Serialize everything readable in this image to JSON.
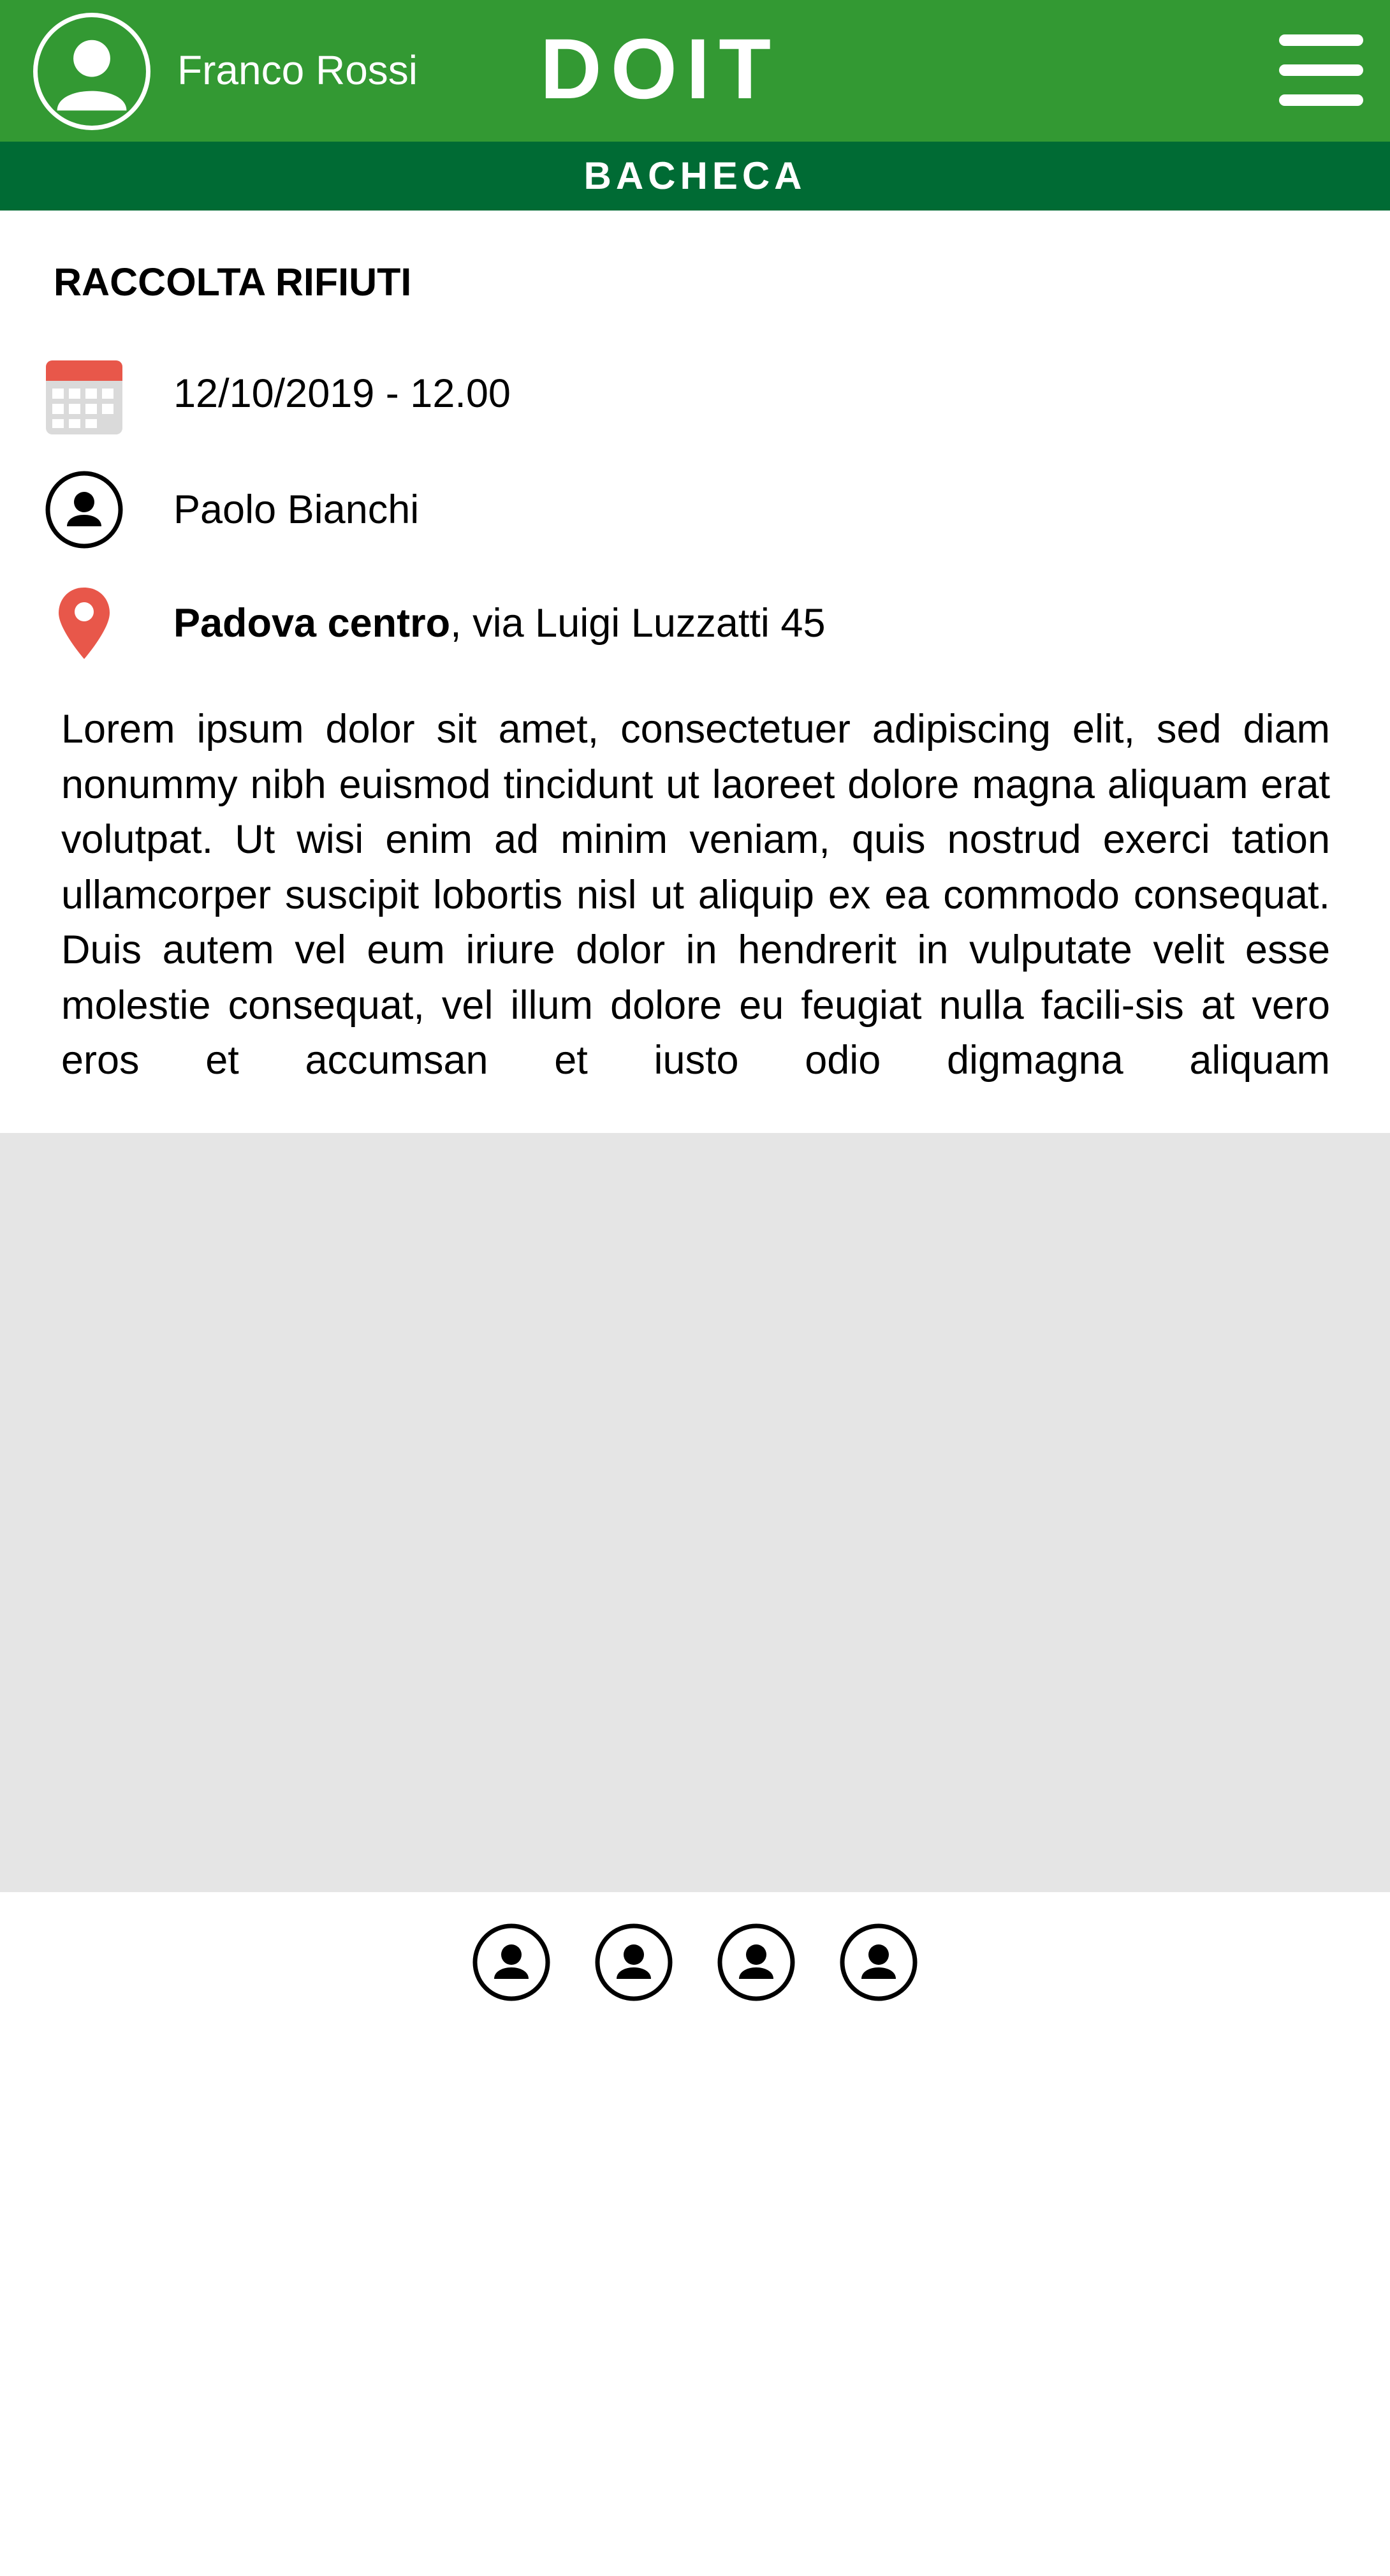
{
  "header": {
    "user_name": "Franco Rossi",
    "app_title": "DOIT",
    "avatar_icon": "user-avatar-icon",
    "menu_icon": "hamburger-menu-icon",
    "background_color": "#339933"
  },
  "subheader": {
    "section_title": "BACHECA",
    "background_color": "#006b34"
  },
  "post": {
    "title": "RACCOLTA RIFIUTI",
    "date_time": "12/10/2019 - 12.00",
    "date_icon": "calendar-icon",
    "organizer": "Paolo Bianchi",
    "organizer_icon": "user-icon",
    "location_name": "Padova centro",
    "location_address": ", via Luigi Luzzatti 45",
    "location_icon": "map-pin-icon",
    "description": "Lorem ipsum dolor sit amet, consectetuer adipiscing elit, sed diam nonummy nibh euismod tincidunt ut laoreet dolore magna aliquam erat volutpat. Ut wisi enim ad minim veniam, quis nostrud exerci tation ullamcorper suscipit lobortis nisl ut aliquip ex ea commodo consequat. Duis autem vel eum iriure dolor in hendrerit in vulputate velit esse molestie consequat, vel illum dolore eu feugiat nulla facili-sis at vero eros et accumsan et iusto odio digmagna aliquam"
  },
  "participants": [
    {
      "icon": "user-icon"
    },
    {
      "icon": "user-icon"
    },
    {
      "icon": "user-icon"
    },
    {
      "icon": "user-icon"
    }
  ],
  "colors": {
    "calendar_accent": "#e8574a",
    "map_pin": "#e8574a",
    "image_placeholder": "#e5e5e5"
  }
}
